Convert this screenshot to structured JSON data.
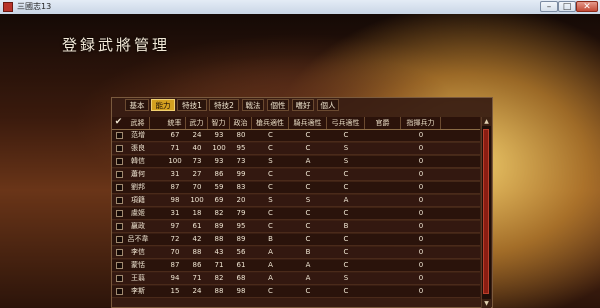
{
  "window": {
    "title": "三國志13",
    "min": "–",
    "max": "□",
    "close": "✕"
  },
  "screen_title": "登録武將管理",
  "tabs": [
    {
      "label": "基本",
      "active": false
    },
    {
      "label": "能力",
      "active": true
    },
    {
      "label": "特技1",
      "active": false
    },
    {
      "label": "特技2",
      "active": false
    },
    {
      "label": "戦法",
      "active": false
    },
    {
      "label": "個性",
      "active": false
    },
    {
      "label": "嗜好",
      "active": false
    },
    {
      "label": "個人",
      "active": false
    }
  ],
  "columns": [
    "武將",
    "統率",
    "武力",
    "智力",
    "政治",
    "槍兵適性",
    "騎兵適性",
    "弓兵適性",
    "官爵",
    "指揮兵力"
  ],
  "check_mark": "✔",
  "rows": [
    [
      "范增",
      "67",
      "24",
      "93",
      "80",
      "C",
      "C",
      "C",
      "",
      "0"
    ],
    [
      "張良",
      "71",
      "40",
      "100",
      "95",
      "C",
      "C",
      "S",
      "",
      "0"
    ],
    [
      "韓信",
      "100",
      "73",
      "93",
      "73",
      "S",
      "A",
      "S",
      "",
      "0"
    ],
    [
      "蕭何",
      "31",
      "27",
      "86",
      "99",
      "C",
      "C",
      "C",
      "",
      "0"
    ],
    [
      "劉邦",
      "87",
      "70",
      "59",
      "83",
      "C",
      "C",
      "C",
      "",
      "0"
    ],
    [
      "項籍",
      "98",
      "100",
      "69",
      "20",
      "S",
      "S",
      "A",
      "",
      "0"
    ],
    [
      "虞姬",
      "31",
      "18",
      "82",
      "79",
      "C",
      "C",
      "C",
      "",
      "0"
    ],
    [
      "嬴政",
      "97",
      "61",
      "89",
      "95",
      "C",
      "C",
      "B",
      "",
      "0"
    ],
    [
      "呂不韋",
      "72",
      "42",
      "88",
      "89",
      "B",
      "C",
      "C",
      "",
      "0"
    ],
    [
      "李信",
      "70",
      "88",
      "43",
      "56",
      "A",
      "B",
      "C",
      "",
      "0"
    ],
    [
      "蒙恬",
      "87",
      "86",
      "71",
      "61",
      "A",
      "A",
      "C",
      "",
      "0"
    ],
    [
      "王翦",
      "94",
      "71",
      "82",
      "68",
      "A",
      "A",
      "S",
      "",
      "0"
    ],
    [
      "李斯",
      "15",
      "24",
      "88",
      "98",
      "C",
      "C",
      "C",
      "",
      "0"
    ]
  ],
  "scroll": {
    "up": "▲",
    "down": "▼"
  }
}
